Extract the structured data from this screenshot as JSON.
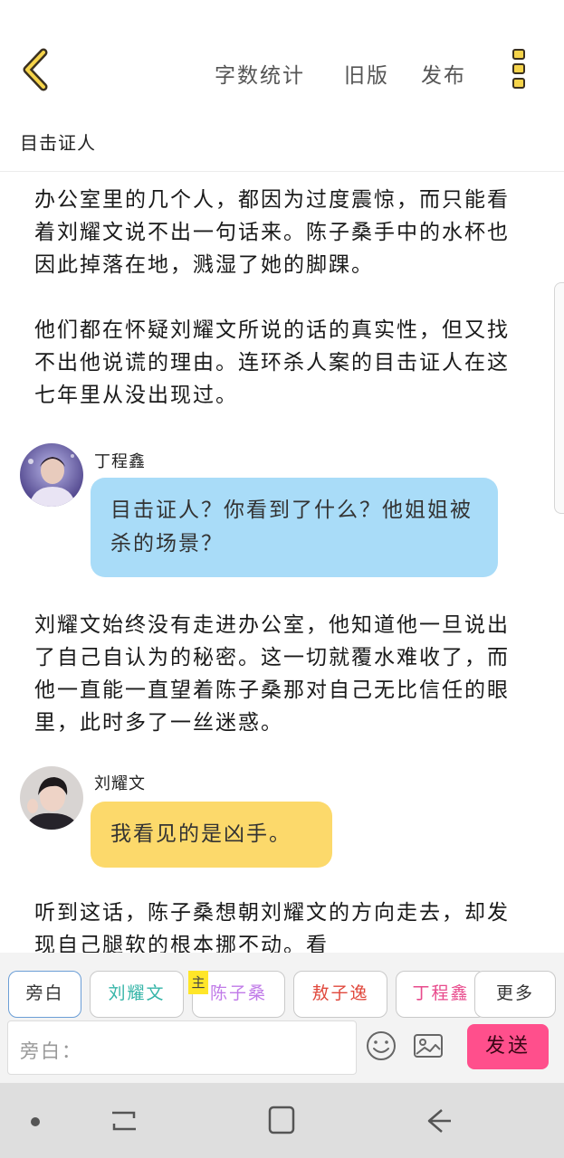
{
  "header": {
    "actions": [
      "字数统计",
      "旧版",
      "发布"
    ],
    "story_title": "目击证人"
  },
  "content": {
    "narration_1": "办公室里的几个人，都因为过度震惊，而只能看着刘耀文说不出一句话来。陈子桑手中的水杯也因此掉落在地，溅湿了她的脚踝。",
    "narration_2": "他们都在怀疑刘耀文所说的话的真实性，但又找不出他说谎的理由。连环杀人案的目击证人在这七年里从没出现过。",
    "message_1": {
      "name": "丁程鑫",
      "text": "目击证人？你看到了什么？他姐姐被杀的场景？"
    },
    "narration_3": "刘耀文始终没有走进办公室，他知道他一旦说出了自己自认为的秘密。这一切就覆水难收了，而他一直能一直望着陈子桑那对自己无比信任的眼里，此时多了一丝迷惑。",
    "message_2": {
      "name": "刘耀文",
      "text": "我看见的是凶手。"
    },
    "narration_4": "听到这话，陈子桑想朝刘耀文的方向走去，却发现自己腿软的根本挪不动。看"
  },
  "roles": {
    "items": [
      {
        "label": "旁白",
        "color": "#333333"
      },
      {
        "label": "刘耀文",
        "color": "#36b5a8"
      },
      {
        "label": "陈子桑",
        "color": "#c07ae8"
      },
      {
        "label": "敖子逸",
        "color": "#e0483c"
      },
      {
        "label": "丁程鑫",
        "color": "#e84a8c"
      }
    ],
    "more_label": "更多",
    "badge": "主"
  },
  "composer": {
    "input_label": "旁白：",
    "send_label": "发送"
  },
  "colors": {
    "accent_yellow": "#f6d44a",
    "bubble_blue": "#a9dcf8",
    "bubble_yellow": "#fcd96b",
    "send_pink": "#ff4f8c"
  },
  "icons": [
    "back-chevron-icon",
    "kebab-menu-icon",
    "emoji-icon",
    "image-icon",
    "nav-dot-icon",
    "recent-apps-icon",
    "home-icon",
    "back-arrow-icon"
  ]
}
